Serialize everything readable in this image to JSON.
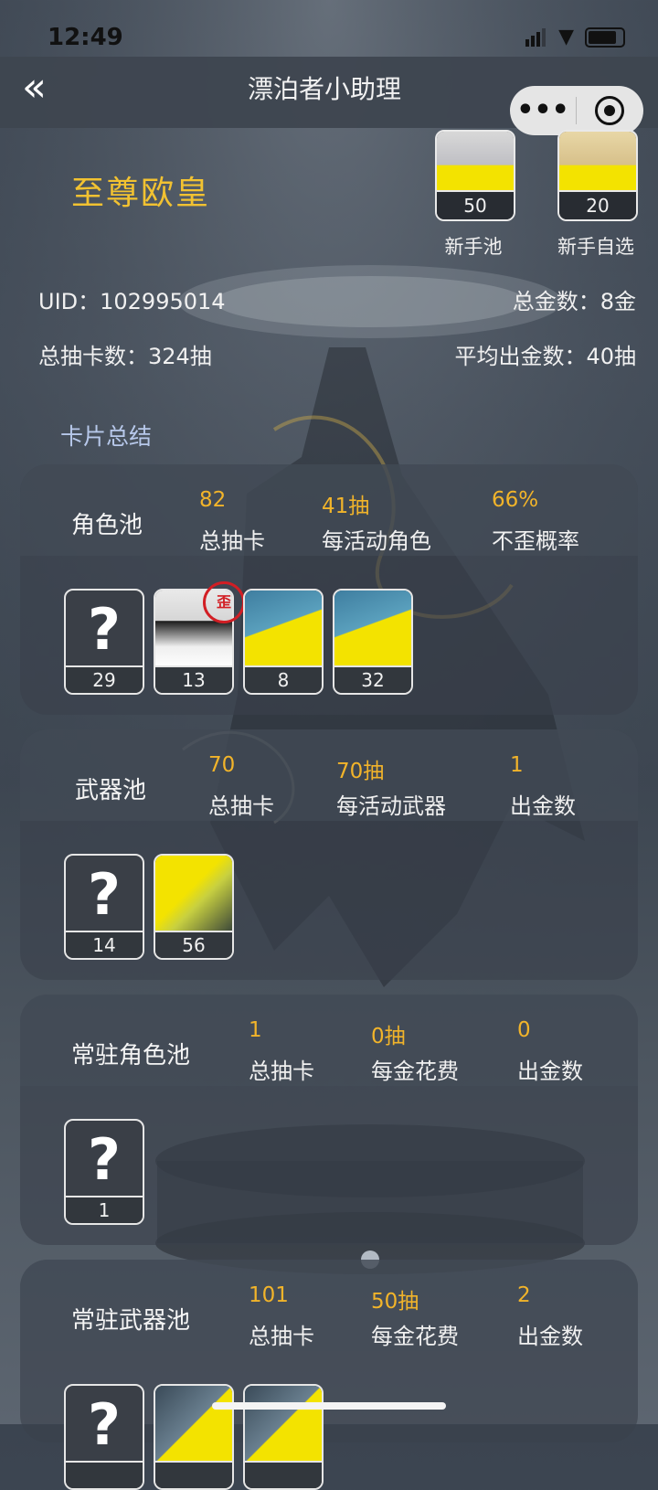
{
  "status_bar": {
    "time": "12:49"
  },
  "nav": {
    "back_icon": "double-chevron-left-icon",
    "title": "漂泊者小助理",
    "more_icon": "more-dots-icon",
    "close_icon": "target-circle-icon"
  },
  "header": {
    "rank": "至尊欧皇",
    "pools": [
      {
        "label": "新手池",
        "count": "50"
      },
      {
        "label": "新手自选",
        "count": "20"
      }
    ],
    "uid": "UID：102995014",
    "total_gold": "总金数：8金",
    "total_pulls": "总抽卡数：324抽",
    "avg_gold": "平均出金数：40抽"
  },
  "section_title": "卡片总结",
  "pools": [
    {
      "name": "角色池",
      "stats": [
        {
          "value": "82",
          "label": "总抽卡"
        },
        {
          "value": "41抽",
          "label": "每活动角色"
        },
        {
          "value": "66%",
          "label": "不歪概率"
        }
      ],
      "cards": [
        {
          "type": "unknown",
          "count": "29"
        },
        {
          "type": "character",
          "count": "13",
          "stamp": "歪"
        },
        {
          "type": "character",
          "count": "8"
        },
        {
          "type": "character",
          "count": "32"
        }
      ]
    },
    {
      "name": "武器池",
      "stats": [
        {
          "value": "70",
          "label": "总抽卡"
        },
        {
          "value": "70抽",
          "label": "每活动武器"
        },
        {
          "value": "1",
          "label": "出金数"
        }
      ],
      "cards": [
        {
          "type": "unknown",
          "count": "14"
        },
        {
          "type": "weapon",
          "count": "56"
        }
      ]
    },
    {
      "name": "常驻角色池",
      "stats": [
        {
          "value": "1",
          "label": "总抽卡"
        },
        {
          "value": "0抽",
          "label": "每金花费"
        },
        {
          "value": "0",
          "label": "出金数"
        }
      ],
      "cards": [
        {
          "type": "unknown",
          "count": "1"
        }
      ]
    },
    {
      "name": "常驻武器池",
      "stats": [
        {
          "value": "101",
          "label": "总抽卡"
        },
        {
          "value": "50抽",
          "label": "每金花费"
        },
        {
          "value": "2",
          "label": "出金数"
        }
      ],
      "cards": [
        {
          "type": "unknown",
          "count": ""
        },
        {
          "type": "weapon",
          "count": ""
        },
        {
          "type": "weapon",
          "count": ""
        }
      ]
    }
  ],
  "colors": {
    "gold": "#f2b42a",
    "rank": "#f2c231",
    "section_title": "#b7c8ea",
    "stamp": "#d21e24"
  }
}
